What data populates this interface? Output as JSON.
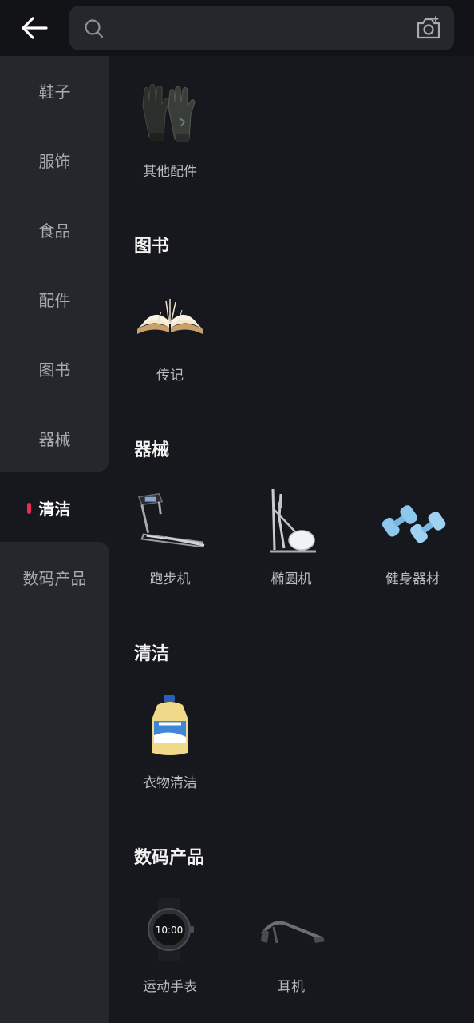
{
  "search": {
    "placeholder": ""
  },
  "sidebar": {
    "items": [
      {
        "label": "鞋子"
      },
      {
        "label": "服饰"
      },
      {
        "label": "食品"
      },
      {
        "label": "配件"
      },
      {
        "label": "图书"
      },
      {
        "label": "器械"
      },
      {
        "label": "清洁",
        "active": true
      },
      {
        "label": "数码产品"
      }
    ],
    "active_color": "#ee2a4f"
  },
  "sections": [
    {
      "title": "",
      "products": [
        {
          "label": "其他配件",
          "icon": "gloves-image"
        }
      ]
    },
    {
      "title": "图书",
      "products": [
        {
          "label": "传记",
          "icon": "open-book-image"
        }
      ]
    },
    {
      "title": "器械",
      "products": [
        {
          "label": "跑步机",
          "icon": "treadmill-image"
        },
        {
          "label": "椭圆机",
          "icon": "elliptical-machine-image"
        },
        {
          "label": "健身器材",
          "icon": "dumbbells-image"
        }
      ]
    },
    {
      "title": "清洁",
      "products": [
        {
          "label": "衣物清洁",
          "icon": "laundry-detergent-image"
        }
      ]
    },
    {
      "title": "数码产品",
      "products": [
        {
          "label": "运动手表",
          "icon": "smartwatch-image",
          "watch_time": "10:00"
        },
        {
          "label": "耳机",
          "icon": "headphones-image"
        }
      ]
    }
  ]
}
